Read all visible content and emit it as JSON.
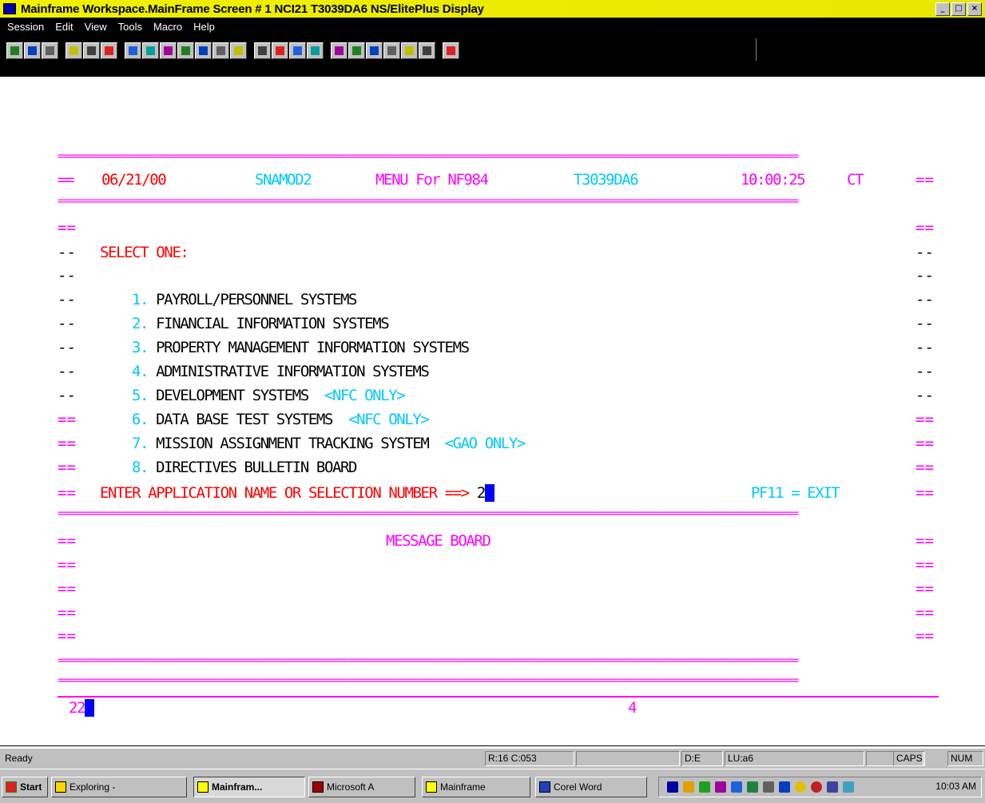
{
  "window": {
    "title": "Mainframe Workspace.MainFrame Screen # 1   NCI21   T3039DA6   NS/ElitePlus Display",
    "controls": [
      "_",
      "□",
      "×"
    ]
  },
  "menubar": [
    "Session",
    "Edit",
    "View",
    "Tools",
    "Macro",
    "Help"
  ],
  "toolbar": {
    "groups": [
      [
        "session-icon",
        "transfer-icon",
        "properties-icon"
      ],
      [
        "cut-icon",
        "copy-icon",
        "paste-icon"
      ],
      [
        "select-icon",
        "record-icon",
        "play-icon",
        "stop-icon",
        "macro-icon",
        "send-icon",
        "receive-icon"
      ],
      [
        "keyboard-icon",
        "display-icon",
        "hotspot-icon",
        "screen-icon"
      ],
      [
        "pf1-icon",
        "pf2-icon",
        "pf3-icon",
        "pf4-icon",
        "print-icon",
        "window-icon"
      ],
      [
        "help-icon"
      ]
    ]
  },
  "terminal": {
    "header": {
      "date": "06/21/00",
      "program": "SNAMOD2",
      "menu_title": "MENU For NF984",
      "terminal_id": "T3039DA6",
      "time": "10:00:25",
      "tz": "CT"
    },
    "select_label": "SELECT ONE:",
    "options": [
      {
        "num": "1.",
        "label": "PAYROLL/PERSONNEL SYSTEMS",
        "note": ""
      },
      {
        "num": "2.",
        "label": "FINANCIAL INFORMATION SYSTEMS",
        "note": ""
      },
      {
        "num": "3.",
        "label": "PROPERTY MANAGEMENT INFORMATION SYSTEMS",
        "note": ""
      },
      {
        "num": "4.",
        "label": "ADMINISTRATIVE INFORMATION SYSTEMS",
        "note": ""
      },
      {
        "num": "5.",
        "label": "DEVELOPMENT SYSTEMS",
        "note": "<NFC ONLY>"
      },
      {
        "num": "6.",
        "label": "DATA BASE TEST SYSTEMS",
        "note": "<NFC ONLY>"
      },
      {
        "num": "7.",
        "label": "MISSION ASSIGNMENT TRACKING SYSTEM",
        "note": "<GAO ONLY>"
      },
      {
        "num": "8.",
        "label": "DIRECTIVES BULLETIN BOARD",
        "note": ""
      }
    ],
    "prompt": "ENTER APPLICATION NAME OR SELECTION NUMBER ==>",
    "input_value": "2",
    "exit_hint": "PF11 = EXIT",
    "message_board_title": "MESSAGE BOARD",
    "command_line": "22",
    "command_marker": "4"
  },
  "statusbar": {
    "state": "Ready",
    "cursor_pos": "R:16 C:053",
    "field_a": "",
    "mode": "D:E",
    "lu": "LU:a6",
    "field_b": "",
    "caps": "CAPS",
    "num": "NUM"
  },
  "taskbar": {
    "start": "Start",
    "tasks": [
      "Exploring -",
      "Mainfram...",
      "Microsoft A",
      "Mainframe",
      "Corel Word"
    ],
    "clock": "10:03 AM"
  }
}
